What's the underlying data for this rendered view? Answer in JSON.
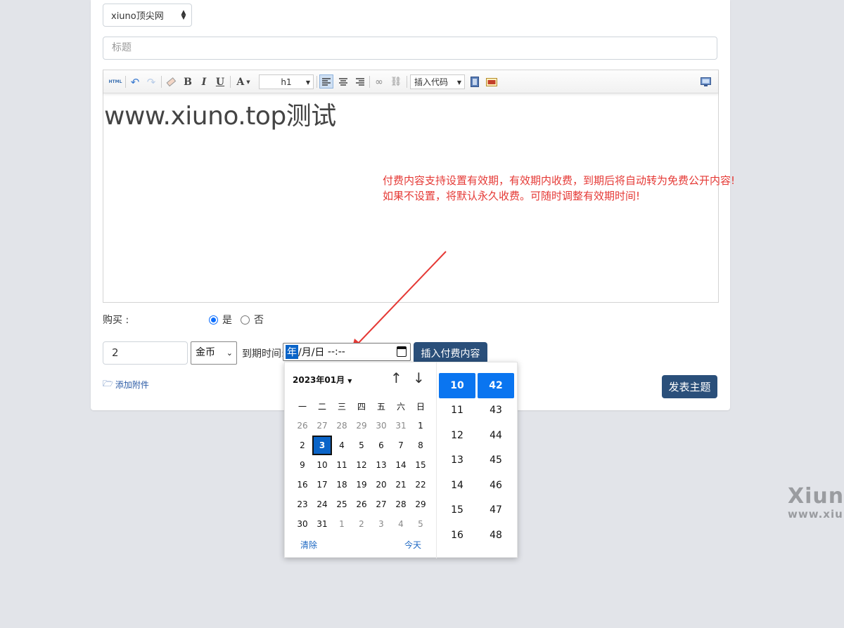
{
  "forum_select": {
    "value": "xiuno顶尖网"
  },
  "title_input": {
    "placeholder": "标题"
  },
  "toolbar": {
    "html_label": "HTML",
    "bold": "B",
    "italic": "I",
    "underline": "U",
    "font_color": "A",
    "heading": "h1",
    "insert_code": "插入代码"
  },
  "editor": {
    "content": "www.xiuno.top测试"
  },
  "note": {
    "line1": "付费内容支持设置有效期，有效期内收费，到期后将自动转为免费公开内容!",
    "line2": "如果不设置，将默认永久收费。可随时调整有效期时间!"
  },
  "buy": {
    "label": "购买 :",
    "yes": "是",
    "no": "否",
    "selected": "yes"
  },
  "price": {
    "value": "2"
  },
  "unit": {
    "value": "金币"
  },
  "expire": {
    "label": "到期时间:",
    "year": "年",
    "month": "/月",
    "day": "/日",
    "time": " --:--"
  },
  "insert_button": "插入付费内容",
  "attach": "添加附件",
  "publish_button": "发表主题",
  "picker": {
    "month_label": "2023年01月",
    "weekdays": [
      "一",
      "二",
      "三",
      "四",
      "五",
      "六",
      "日"
    ],
    "weeks": [
      [
        "26",
        "27",
        "28",
        "29",
        "30",
        "31",
        "1"
      ],
      [
        "2",
        "3",
        "4",
        "5",
        "6",
        "7",
        "8"
      ],
      [
        "9",
        "10",
        "11",
        "12",
        "13",
        "14",
        "15"
      ],
      [
        "16",
        "17",
        "18",
        "19",
        "20",
        "21",
        "22"
      ],
      [
        "23",
        "24",
        "25",
        "26",
        "27",
        "28",
        "29"
      ],
      [
        "30",
        "31",
        "1",
        "2",
        "3",
        "4",
        "5"
      ]
    ],
    "selected_day": "3",
    "clear": "清除",
    "today": "今天",
    "hours": [
      "10",
      "11",
      "12",
      "13",
      "14",
      "15",
      "16"
    ],
    "minutes": [
      "42",
      "43",
      "44",
      "45",
      "46",
      "47",
      "48"
    ],
    "selected_hour": "10",
    "selected_minute": "42"
  },
  "watermark": {
    "big": "Xiuno",
    "small": "www.xiuno"
  },
  "colors": {
    "accent": "#2a4f7a",
    "note": "#e53935",
    "picker_select": "#0a64c8"
  }
}
